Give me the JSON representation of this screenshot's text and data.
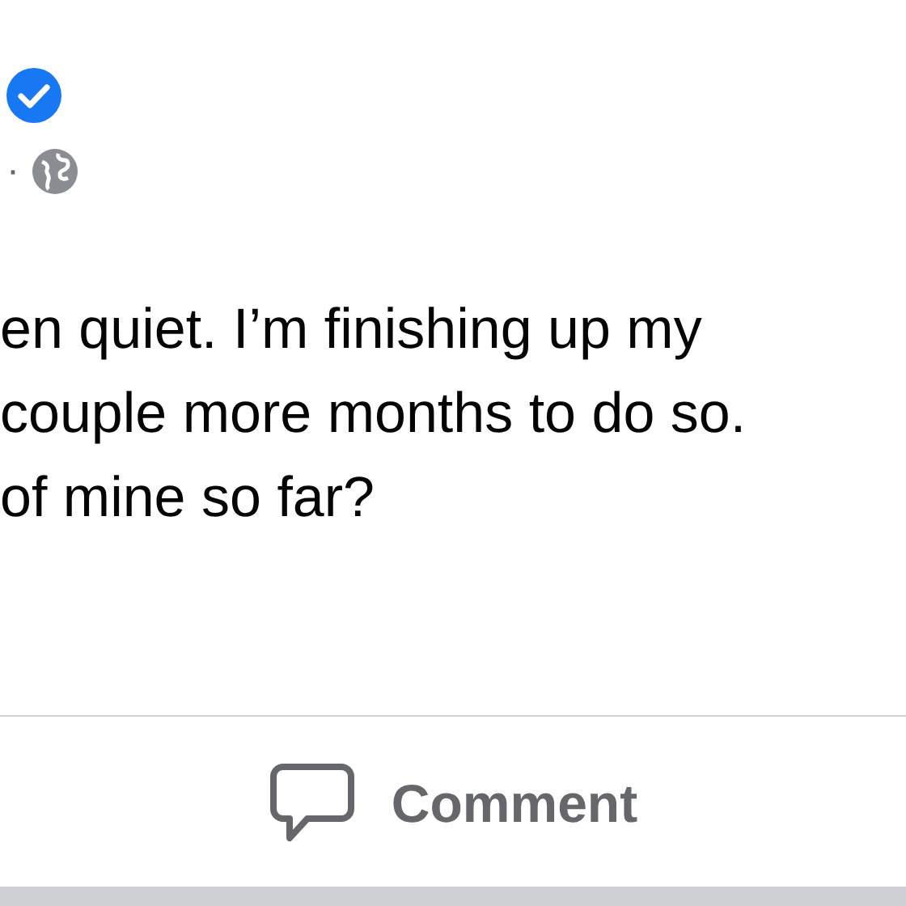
{
  "post": {
    "verified": true,
    "separator": "·",
    "public": true,
    "text_lines": [
      "en quiet. I’m finishing up my",
      "couple more months to do so.",
      "of mine so far?"
    ]
  },
  "actions": [
    {
      "label": "Comment"
    }
  ]
}
